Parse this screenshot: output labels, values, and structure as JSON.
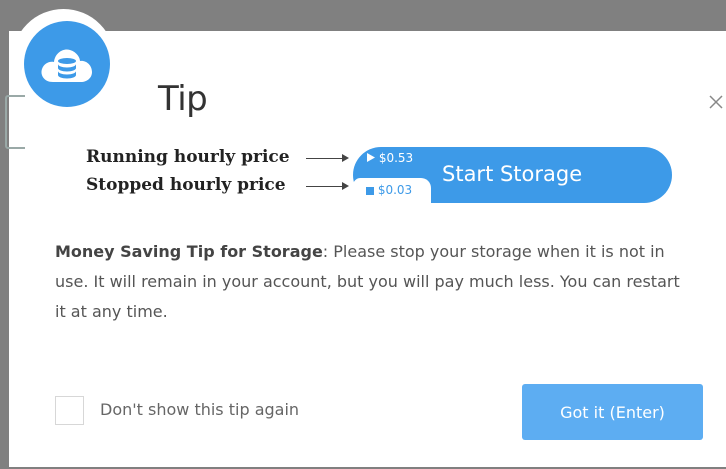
{
  "dialog": {
    "title": "Tip",
    "logo_icon": "cloud-storage-icon",
    "close_icon": "close-icon"
  },
  "legend": {
    "running_label": "Running hourly price",
    "stopped_label": "Stopped hourly price"
  },
  "storage_button": {
    "label": "Start Storage",
    "running_price": "$0.53",
    "stopped_price": "$0.03",
    "running_icon": "play-icon",
    "stopped_icon": "stop-icon"
  },
  "tip": {
    "bold": "Money Saving Tip for Storage",
    "body": ": Please stop your storage when it is not in use. It will remain in your account, but you will pay much less. You can restart it at any time."
  },
  "footer": {
    "checkbox_label": "Don't show this tip again",
    "checkbox_checked": false,
    "confirm_label": "Got it (Enter)"
  },
  "colors": {
    "accent": "#3d9ae8",
    "confirm_button": "#5dadf2",
    "backdrop": "#808080"
  }
}
